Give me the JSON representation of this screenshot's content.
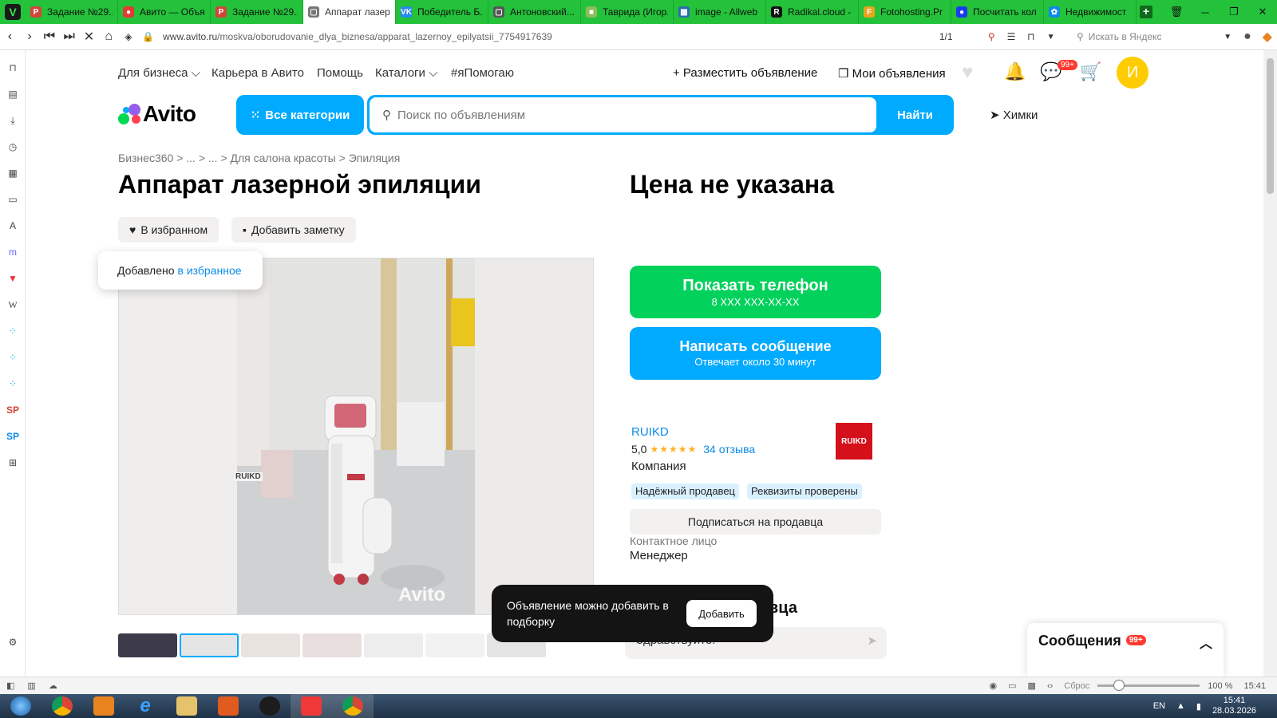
{
  "browser": {
    "tabs": [
      {
        "label": "Задание №29...",
        "icon": "P",
        "color": "#d4443a"
      },
      {
        "label": "Авито — Объя...",
        "icon": "●",
        "color": "#e53935"
      },
      {
        "label": "Задание №29...",
        "icon": "P",
        "color": "#d4443a"
      },
      {
        "label": "Аппарат лазер...",
        "icon": "▢",
        "color": "#777777"
      },
      {
        "label": "Победитель Б...",
        "icon": "VK",
        "color": "#2787f5"
      },
      {
        "label": "Антоновский...",
        "icon": "▢",
        "color": "#555555"
      },
      {
        "label": "Таврида (Игор...",
        "icon": "■",
        "color": "#8fbc5a"
      },
      {
        "label": "image - Allweb",
        "icon": "▦",
        "color": "#2b6cb0"
      },
      {
        "label": "Radikal.cloud -",
        "icon": "R",
        "color": "#111111"
      },
      {
        "label": "Fotohosting.Pr",
        "icon": "F",
        "color": "#e9a31c"
      },
      {
        "label": "Посчитать кол",
        "icon": "●",
        "color": "#1a3cf0"
      },
      {
        "label": "Недвижимост",
        "icon": "✿",
        "color": "#0a8ce8"
      }
    ],
    "url_domain": "www.avito.ru",
    "url_path": "/moskva/oborudovanie_dlya_biznesa/apparat_lazernoy_epilyatsii_7754917639",
    "page_counter": "1/1",
    "yandex_placeholder": "Искать в Яндекс"
  },
  "avito": {
    "topnav": [
      {
        "label": "Для бизнеса ⌵"
      },
      {
        "label": "Карьера в Авито"
      },
      {
        "label": "Помощь"
      },
      {
        "label": "Каталоги ⌵"
      },
      {
        "label": "#яПомогаю"
      }
    ],
    "post_ad": "+ Разместить объявление",
    "my_ads": "Мои объявления",
    "msg_badge": "99+",
    "avatar_letter": "И",
    "logo_text": "Avito",
    "all_categories": "Все категории",
    "search_placeholder": "Поиск по объявлениям",
    "search_button": "Найти",
    "location": "Химки",
    "breadcrumbs": "Бизнес360 > ... > ... > Для салона красоты > Эпиляция",
    "title": "Аппарат лазерной эпиляции",
    "price": "Цена не указана",
    "favorite_button": "В избранном",
    "note_button": "Добавить заметку",
    "fav_toast_text": "Добавлено",
    "fav_toast_link": "в избранное",
    "phone_button": "Показать телефон",
    "phone_sub": "8 XXX XXX-XX-XX",
    "message_button": "Написать сообщение",
    "message_sub": "Отвечает около 30 минут",
    "seller_name": "RUIKD",
    "seller_rating": "5,0",
    "reviews_link": "34 отзыва",
    "seller_type": "Компания",
    "seller_logo_text": "RUIKD",
    "badges": [
      "Надёжный продавец",
      "Реквизиты проверены"
    ],
    "subscribe_button": "Подписаться на продавца",
    "contact_label": "Контактное лицо",
    "contact_value": "Менеджер",
    "ask_seller": "вца",
    "hello_text": "Здравствуйте!",
    "watermark": "Avito",
    "device_brand": "RUIKD",
    "collection_toast": "Объявление можно добавить в подборку",
    "collection_add": "Добавить",
    "messages_panel": "Сообщения",
    "messages_badge": "99+"
  },
  "statusbar": {
    "reset": "Сброс",
    "zoom": "100 %",
    "time": "15:41"
  },
  "taskbar": {
    "lang": "EN",
    "time": "15:41",
    "date": "28.03.2026"
  }
}
